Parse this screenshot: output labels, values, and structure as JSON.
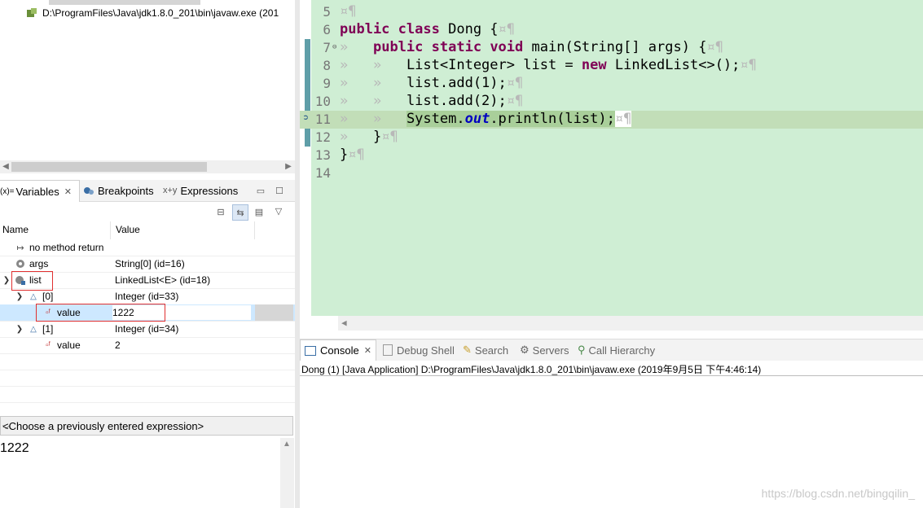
{
  "debug_tree": {
    "process_label": "D:\\ProgramFiles\\Java\\jdk1.8.0_201\\bin\\javaw.exe (201"
  },
  "variables_view": {
    "tabs": [
      {
        "label": "Variables",
        "icon": "variables-icon",
        "active": true
      },
      {
        "label": "Breakpoints",
        "icon": "breakpoints-icon",
        "active": false
      },
      {
        "label": "Expressions",
        "icon": "expressions-icon",
        "active": false
      }
    ],
    "tab_prefix": "(x)=",
    "columns": {
      "name": "Name",
      "value": "Value"
    },
    "rows": [
      {
        "name": "no method return",
        "value": ""
      },
      {
        "name": "args",
        "value": "String[0]  (id=16)"
      },
      {
        "name": "list",
        "value": "LinkedList<E>  (id=18)"
      },
      {
        "name": "[0]",
        "value": "Integer  (id=33)"
      },
      {
        "name": "value",
        "value": "1222"
      },
      {
        "name": "[1]",
        "value": "Integer  (id=34)"
      },
      {
        "name": "value",
        "value": "2"
      }
    ],
    "expression_combo": "<Choose a previously entered expression>",
    "expression_text": "1222"
  },
  "editor": {
    "lines": [
      {
        "num": "5",
        "text": ""
      },
      {
        "num": "6",
        "text": "public class Dong {"
      },
      {
        "num": "7",
        "text": "public static void main(String[] args) {"
      },
      {
        "num": "8",
        "text": "List<Integer> list = new LinkedList<>();"
      },
      {
        "num": "9",
        "text": "list.add(1);"
      },
      {
        "num": "10",
        "text": "list.add(2);"
      },
      {
        "num": "11",
        "text": "System.out.println(list);"
      },
      {
        "num": "12",
        "text": "}"
      },
      {
        "num": "13",
        "text": "}"
      },
      {
        "num": "14",
        "text": ""
      }
    ],
    "tokens": {
      "public": "public",
      "class": "class",
      "static": "static",
      "void": "void",
      "new": "new",
      "dong": "Dong {",
      "main_sig": "main(String[] args) {",
      "list_decl": "List<Integer> ",
      "list_var": "list",
      "assign": " = ",
      "ctor": "LinkedList<>();",
      "add1": "list.add(1);",
      "add2": "list.add(2);",
      "sys": "System.",
      "out": "out",
      "println": ".println(list);",
      "close": "}",
      "marker": "¤¶",
      "tab": "»"
    }
  },
  "console_view": {
    "tabs": [
      {
        "label": "Console",
        "icon": "console-icon",
        "active": true
      },
      {
        "label": "Debug Shell",
        "icon": "debug-shell-icon",
        "active": false
      },
      {
        "label": "Search",
        "icon": "search-icon",
        "active": false
      },
      {
        "label": "Servers",
        "icon": "servers-icon",
        "active": false
      },
      {
        "label": "Call Hierarchy",
        "icon": "call-hierarchy-icon",
        "active": false
      }
    ],
    "status": "Dong (1) [Java Application] D:\\ProgramFiles\\Java\\jdk1.8.0_201\\bin\\javaw.exe (2019年9月5日 下午4:46:14)"
  },
  "watermark": "https://blog.csdn.net/bingqilin_",
  "colors": {
    "editor_bg": "#cfeed4",
    "current_line": "#c2deb8",
    "keyword": "#7f0055",
    "field": "#0000c0",
    "highlight_box": "#e03030",
    "selected_row": "#cde8ff"
  }
}
